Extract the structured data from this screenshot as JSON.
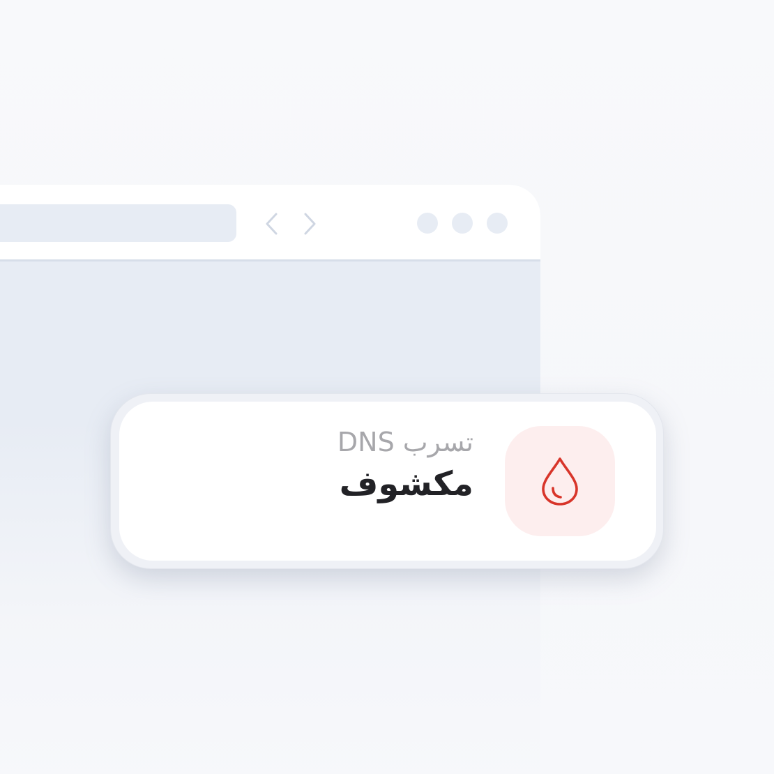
{
  "colors": {
    "background": "#f7f8fb",
    "browser_content": "#e7ecf4",
    "toolbar": "#ffffff",
    "card_background": "#ffffff",
    "icon_tile": "#fdeeee",
    "accent_red": "#d8352a",
    "label_gray": "#a7a7ab",
    "value_dark": "#222226"
  },
  "browser": {
    "icons": {
      "back": "chevron-left-icon",
      "forward": "chevron-right-icon"
    }
  },
  "status_card": {
    "icon": "droplet-icon",
    "label": "تسرب DNS",
    "value": "مكشوف"
  }
}
